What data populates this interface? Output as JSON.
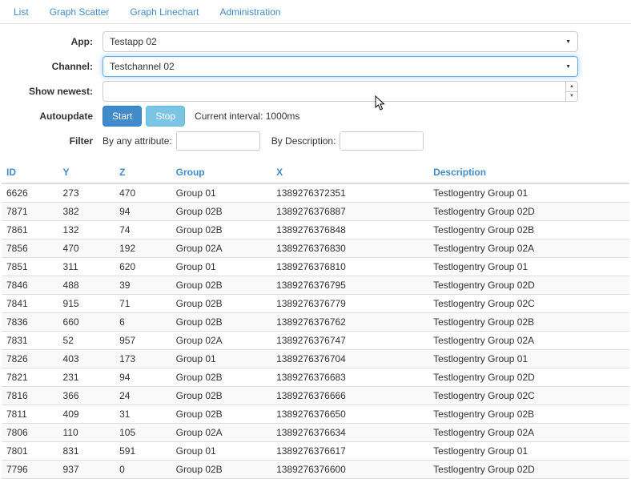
{
  "nav": {
    "items": [
      {
        "label": "List"
      },
      {
        "label": "Graph Scatter"
      },
      {
        "label": "Graph Linechart"
      },
      {
        "label": "Administration"
      }
    ]
  },
  "form": {
    "app": {
      "label": "App:",
      "value": "Testapp 02"
    },
    "channel": {
      "label": "Channel:",
      "value": "Testchannel 02"
    },
    "show_newest": {
      "label": "Show newest:",
      "value": ""
    },
    "autoupdate": {
      "label": "Autoupdate",
      "start_label": "Start",
      "stop_label": "Stop",
      "interval_text": "Current interval: 1000ms"
    },
    "filter": {
      "label": "Filter",
      "by_attribute_label": "By any attribute:",
      "by_attribute_value": "",
      "by_description_label": "By Description:",
      "by_description_value": ""
    }
  },
  "table": {
    "columns": [
      "ID",
      "Y",
      "Z",
      "Group",
      "X",
      "Description"
    ],
    "rows": [
      [
        "6626",
        "273",
        "470",
        "Group 01",
        "1389276372351",
        "Testlogentry Group 01"
      ],
      [
        "7871",
        "382",
        "94",
        "Group 02B",
        "1389276376887",
        "Testlogentry Group 02D"
      ],
      [
        "7861",
        "132",
        "74",
        "Group 02B",
        "1389276376848",
        "Testlogentry Group 02B"
      ],
      [
        "7856",
        "470",
        "192",
        "Group 02A",
        "1389276376830",
        "Testlogentry Group 02A"
      ],
      [
        "7851",
        "311",
        "620",
        "Group 01",
        "1389276376810",
        "Testlogentry Group 01"
      ],
      [
        "7846",
        "488",
        "39",
        "Group 02B",
        "1389276376795",
        "Testlogentry Group 02D"
      ],
      [
        "7841",
        "915",
        "71",
        "Group 02B",
        "1389276376779",
        "Testlogentry Group 02C"
      ],
      [
        "7836",
        "660",
        "6",
        "Group 02B",
        "1389276376762",
        "Testlogentry Group 02B"
      ],
      [
        "7831",
        "52",
        "957",
        "Group 02A",
        "1389276376747",
        "Testlogentry Group 02A"
      ],
      [
        "7826",
        "403",
        "173",
        "Group 01",
        "1389276376704",
        "Testlogentry Group 01"
      ],
      [
        "7821",
        "231",
        "94",
        "Group 02B",
        "1389276376683",
        "Testlogentry Group 02D"
      ],
      [
        "7816",
        "366",
        "24",
        "Group 02B",
        "1389276376666",
        "Testlogentry Group 02C"
      ],
      [
        "7811",
        "409",
        "31",
        "Group 02B",
        "1389276376650",
        "Testlogentry Group 02B"
      ],
      [
        "7806",
        "110",
        "105",
        "Group 02A",
        "1389276376634",
        "Testlogentry Group 02A"
      ],
      [
        "7801",
        "831",
        "591",
        "Group 01",
        "1389276376617",
        "Testlogentry Group 01"
      ],
      [
        "7796",
        "937",
        "0",
        "Group 02B",
        "1389276376600",
        "Testlogentry Group 02D"
      ]
    ]
  },
  "colors": {
    "accent": "#428bca",
    "focus_border": "#66afe9",
    "start_button": "#428bca",
    "stop_button": "#7cc4e4",
    "stripe": "#f9f9f9",
    "border": "#dddddd"
  }
}
